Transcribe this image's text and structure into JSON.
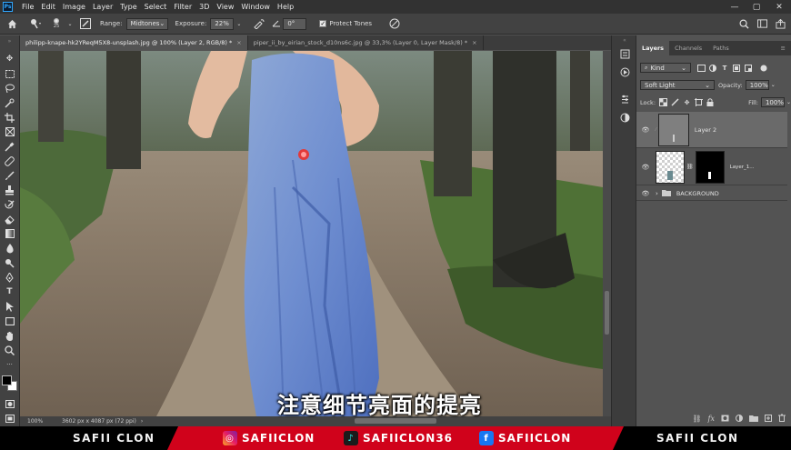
{
  "app": {
    "logo": "Ps"
  },
  "menubar": {
    "items": [
      "File",
      "Edit",
      "Image",
      "Layer",
      "Type",
      "Select",
      "Filter",
      "3D",
      "View",
      "Window",
      "Help"
    ],
    "window_controls": [
      "—",
      "▢",
      "✕"
    ]
  },
  "options_bar": {
    "brush_size": "25",
    "range_label": "Range:",
    "range_value": "Midtones",
    "exposure_label": "Exposure:",
    "exposure_value": "22%",
    "angle_value": "0°",
    "protect_tones_label": "Protect Tones",
    "protect_tones_checked": true
  },
  "document_tabs": [
    {
      "label": "philipp-knape-hk2YReqM5X8-unsplash.jpg @ 100% (Layer 2, RGB/8) *",
      "active": true
    },
    {
      "label": "piper_ii_by_eirian_stock_d10ns6c.jpg @ 33,3% (Layer 0, Layer Mask/8) *",
      "active": false
    }
  ],
  "status_bar": {
    "zoom": "100%",
    "doc_info": "3602 px x 4087 px (72 ppi)"
  },
  "layers_panel": {
    "tabs": [
      "Layers",
      "Channels",
      "Paths"
    ],
    "filter_kind": "Kind",
    "blend_mode": "Soft Light",
    "opacity_label": "Opacity:",
    "opacity_value": "100%",
    "lock_label": "Lock:",
    "fill_label": "Fill:",
    "fill_value": "100%",
    "layers": [
      {
        "name": "Layer 2",
        "selected": true
      },
      {
        "name": "Layer_1...",
        "selected": false
      },
      {
        "name": "BACKGROUND",
        "selected": false
      }
    ]
  },
  "subtitle": "注意细节亮面的提亮",
  "footer": {
    "left_name": "SAFII CLON",
    "right_name": "SAFII CLON",
    "socials": [
      {
        "icon": "instagram-icon",
        "handle": "SAFIICLON"
      },
      {
        "icon": "tiktok-icon",
        "handle": "SAFIICLON36"
      },
      {
        "icon": "facebook-icon",
        "handle": "SAFIICLON"
      }
    ]
  },
  "colors": {
    "accent_red": "#d0021b",
    "ps_blue": "#31a8ff",
    "panel_bg": "#535353"
  }
}
